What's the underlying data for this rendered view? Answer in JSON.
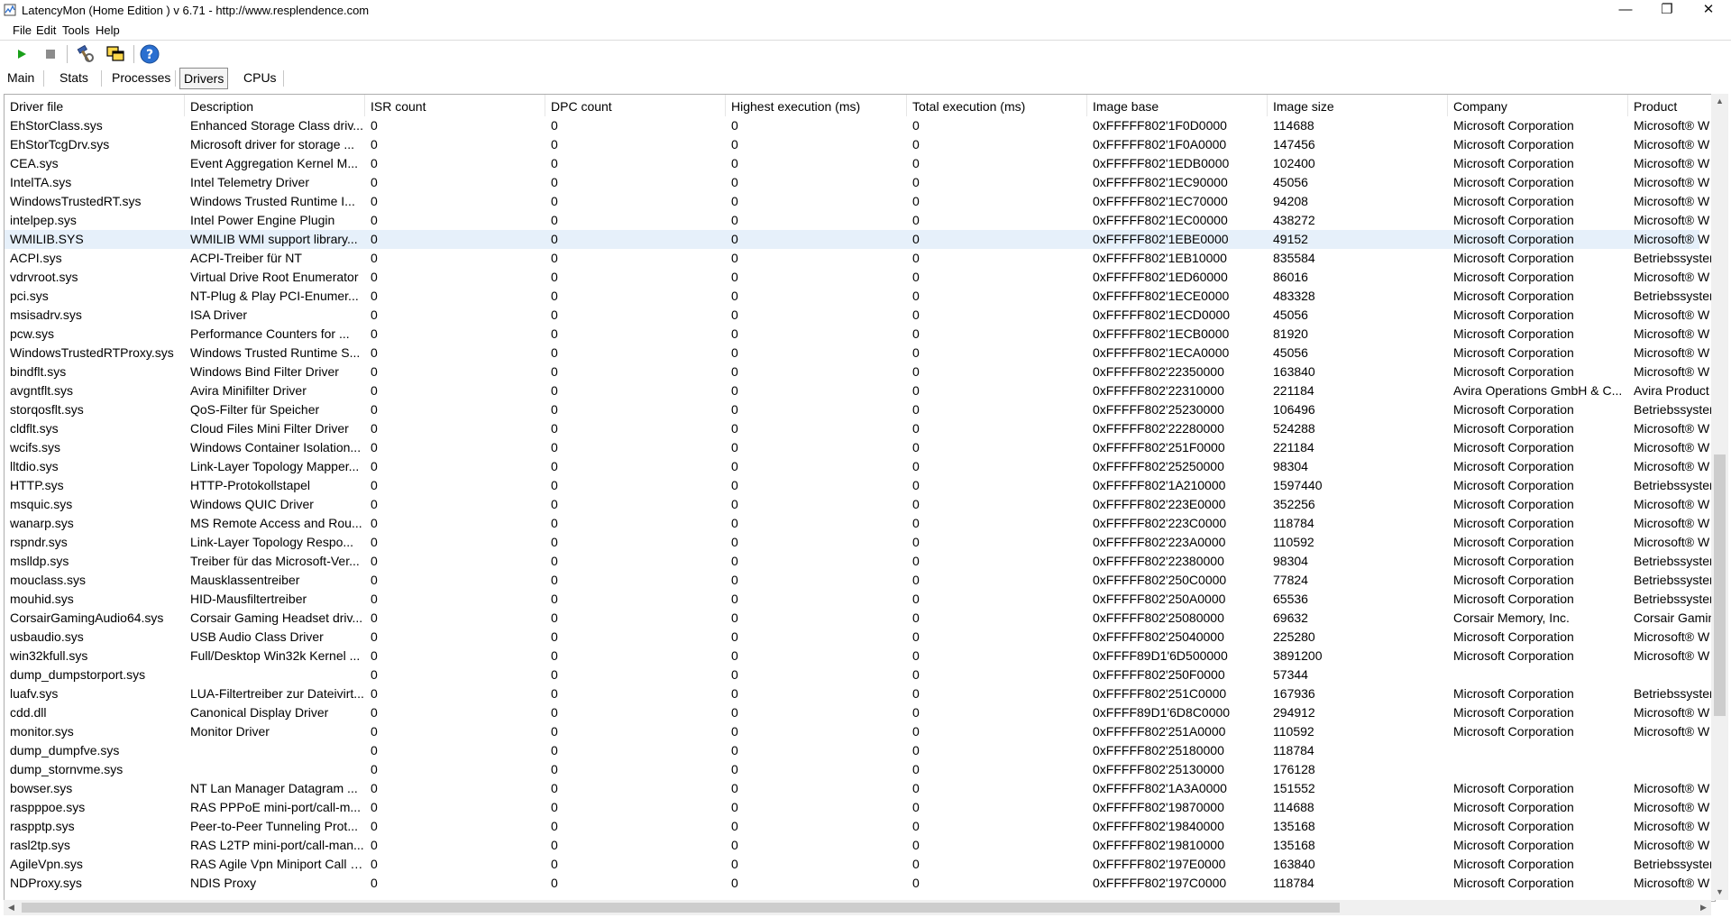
{
  "window": {
    "title": "LatencyMon  (Home Edition )  v 6.71 - http://www.resplendence.com",
    "minimize_glyph": "—",
    "restore_glyph": "❐",
    "close_glyph": "✕"
  },
  "menu": [
    {
      "label": "File"
    },
    {
      "label": "Edit"
    },
    {
      "label": "Tools"
    },
    {
      "label": "Help"
    }
  ],
  "toolbar": {
    "start_icon": "play-icon",
    "stop_icon": "stop-icon",
    "tool1_icon": "wrench-hammer-icon",
    "tool2_icon": "windows-icon",
    "help_icon": "help-icon",
    "start_color": "#1aa01a",
    "help_color": "#2a6fd0"
  },
  "tabs": [
    {
      "label": "Main"
    },
    {
      "label": "Stats"
    },
    {
      "label": "Processes"
    },
    {
      "label": "Drivers",
      "active": true
    },
    {
      "label": "CPUs"
    }
  ],
  "table": {
    "columns": [
      "Driver file",
      "Description",
      "ISR count",
      "DPC count",
      "Highest execution (ms)",
      "Total execution (ms)",
      "Image base",
      "Image size",
      "Company",
      "Product"
    ],
    "selected_row": 6,
    "rows": [
      [
        "EhStorClass.sys",
        "Enhanced Storage Class driv...",
        "0",
        "0",
        "0",
        "0",
        "0xFFFFF802'1F0D0000",
        "114688",
        "Microsoft Corporation",
        "Microsoft® W"
      ],
      [
        "EhStorTcgDrv.sys",
        "Microsoft driver for storage ...",
        "0",
        "0",
        "0",
        "0",
        "0xFFFFF802'1F0A0000",
        "147456",
        "Microsoft Corporation",
        "Microsoft® W"
      ],
      [
        "CEA.sys",
        "Event Aggregation Kernel M...",
        "0",
        "0",
        "0",
        "0",
        "0xFFFFF802'1EDB0000",
        "102400",
        "Microsoft Corporation",
        "Microsoft® W"
      ],
      [
        "IntelTA.sys",
        "Intel Telemetry Driver",
        "0",
        "0",
        "0",
        "0",
        "0xFFFFF802'1EC90000",
        "45056",
        "Microsoft Corporation",
        "Microsoft® W"
      ],
      [
        "WindowsTrustedRT.sys",
        "Windows Trusted Runtime I...",
        "0",
        "0",
        "0",
        "0",
        "0xFFFFF802'1EC70000",
        "94208",
        "Microsoft Corporation",
        "Microsoft® W"
      ],
      [
        "intelpep.sys",
        "Intel Power Engine Plugin",
        "0",
        "0",
        "0",
        "0",
        "0xFFFFF802'1EC00000",
        "438272",
        "Microsoft Corporation",
        "Microsoft® W"
      ],
      [
        "WMILIB.SYS",
        "WMILIB WMI support library...",
        "0",
        "0",
        "0",
        "0",
        "0xFFFFF802'1EBE0000",
        "49152",
        "Microsoft Corporation",
        "Microsoft® W"
      ],
      [
        "ACPI.sys",
        "ACPI-Treiber für NT",
        "0",
        "0",
        "0",
        "0",
        "0xFFFFF802'1EB10000",
        "835584",
        "Microsoft Corporation",
        "Betriebssyster"
      ],
      [
        "vdrvroot.sys",
        "Virtual Drive Root Enumerator",
        "0",
        "0",
        "0",
        "0",
        "0xFFFFF802'1ED60000",
        "86016",
        "Microsoft Corporation",
        "Microsoft® W"
      ],
      [
        "pci.sys",
        "NT-Plug & Play PCI-Enumer...",
        "0",
        "0",
        "0",
        "0",
        "0xFFFFF802'1ECE0000",
        "483328",
        "Microsoft Corporation",
        "Betriebssyster"
      ],
      [
        "msisadrv.sys",
        "ISA Driver",
        "0",
        "0",
        "0",
        "0",
        "0xFFFFF802'1ECD0000",
        "45056",
        "Microsoft Corporation",
        "Microsoft® W"
      ],
      [
        "pcw.sys",
        "Performance Counters for ...",
        "0",
        "0",
        "0",
        "0",
        "0xFFFFF802'1ECB0000",
        "81920",
        "Microsoft Corporation",
        "Microsoft® W"
      ],
      [
        "WindowsTrustedRTProxy.sys",
        "Windows Trusted Runtime S...",
        "0",
        "0",
        "0",
        "0",
        "0xFFFFF802'1ECA0000",
        "45056",
        "Microsoft Corporation",
        "Microsoft® W"
      ],
      [
        "bindflt.sys",
        "Windows Bind Filter Driver",
        "0",
        "0",
        "0",
        "0",
        "0xFFFFF802'22350000",
        "163840",
        "Microsoft Corporation",
        "Microsoft® W"
      ],
      [
        "avgntflt.sys",
        "Avira Minifilter Driver",
        "0",
        "0",
        "0",
        "0",
        "0xFFFFF802'22310000",
        "221184",
        "Avira Operations GmbH & C...",
        "Avira Product"
      ],
      [
        "storqosflt.sys",
        "QoS-Filter für Speicher",
        "0",
        "0",
        "0",
        "0",
        "0xFFFFF802'25230000",
        "106496",
        "Microsoft Corporation",
        "Betriebssyster"
      ],
      [
        "cldflt.sys",
        "Cloud Files Mini Filter Driver",
        "0",
        "0",
        "0",
        "0",
        "0xFFFFF802'22280000",
        "524288",
        "Microsoft Corporation",
        "Microsoft® W"
      ],
      [
        "wcifs.sys",
        "Windows Container Isolation...",
        "0",
        "0",
        "0",
        "0",
        "0xFFFFF802'251F0000",
        "221184",
        "Microsoft Corporation",
        "Microsoft® W"
      ],
      [
        "lltdio.sys",
        "Link-Layer Topology Mapper...",
        "0",
        "0",
        "0",
        "0",
        "0xFFFFF802'25250000",
        "98304",
        "Microsoft Corporation",
        "Microsoft® W"
      ],
      [
        "HTTP.sys",
        "HTTP-Protokollstapel",
        "0",
        "0",
        "0",
        "0",
        "0xFFFFF802'1A210000",
        "1597440",
        "Microsoft Corporation",
        "Betriebssyster"
      ],
      [
        "msquic.sys",
        "Windows QUIC Driver",
        "0",
        "0",
        "0",
        "0",
        "0xFFFFF802'223E0000",
        "352256",
        "Microsoft Corporation",
        "Microsoft® W"
      ],
      [
        "wanarp.sys",
        "MS Remote Access and Rou...",
        "0",
        "0",
        "0",
        "0",
        "0xFFFFF802'223C0000",
        "118784",
        "Microsoft Corporation",
        "Microsoft® W"
      ],
      [
        "rspndr.sys",
        "Link-Layer Topology Respo...",
        "0",
        "0",
        "0",
        "0",
        "0xFFFFF802'223A0000",
        "110592",
        "Microsoft Corporation",
        "Microsoft® W"
      ],
      [
        "mslldp.sys",
        "Treiber für das Microsoft-Ver...",
        "0",
        "0",
        "0",
        "0",
        "0xFFFFF802'22380000",
        "98304",
        "Microsoft Corporation",
        "Betriebssyster"
      ],
      [
        "mouclass.sys",
        "Mausklassentreiber",
        "0",
        "0",
        "0",
        "0",
        "0xFFFFF802'250C0000",
        "77824",
        "Microsoft Corporation",
        "Betriebssyster"
      ],
      [
        "mouhid.sys",
        "HID-Mausfiltertreiber",
        "0",
        "0",
        "0",
        "0",
        "0xFFFFF802'250A0000",
        "65536",
        "Microsoft Corporation",
        "Betriebssyster"
      ],
      [
        "CorsairGamingAudio64.sys",
        "Corsair Gaming Headset driv...",
        "0",
        "0",
        "0",
        "0",
        "0xFFFFF802'25080000",
        "69632",
        "Corsair Memory, Inc.",
        "Corsair Gamin"
      ],
      [
        "usbaudio.sys",
        "USB Audio Class Driver",
        "0",
        "0",
        "0",
        "0",
        "0xFFFFF802'25040000",
        "225280",
        "Microsoft Corporation",
        "Microsoft® W"
      ],
      [
        "win32kfull.sys",
        "Full/Desktop Win32k Kernel ...",
        "0",
        "0",
        "0",
        "0",
        "0xFFFF89D1'6D500000",
        "3891200",
        "Microsoft Corporation",
        "Microsoft® W"
      ],
      [
        "dump_dumpstorport.sys",
        "",
        "0",
        "0",
        "0",
        "0",
        "0xFFFFF802'250F0000",
        "57344",
        "",
        ""
      ],
      [
        "luafv.sys",
        "LUA-Filtertreiber zur Dateivirt...",
        "0",
        "0",
        "0",
        "0",
        "0xFFFFF802'251C0000",
        "167936",
        "Microsoft Corporation",
        "Betriebssyster"
      ],
      [
        "cdd.dll",
        "Canonical Display Driver",
        "0",
        "0",
        "0",
        "0",
        "0xFFFF89D1'6D8C0000",
        "294912",
        "Microsoft Corporation",
        "Microsoft® W"
      ],
      [
        "monitor.sys",
        "Monitor Driver",
        "0",
        "0",
        "0",
        "0",
        "0xFFFFF802'251A0000",
        "110592",
        "Microsoft Corporation",
        "Microsoft® W"
      ],
      [
        "dump_dumpfve.sys",
        "",
        "0",
        "0",
        "0",
        "0",
        "0xFFFFF802'25180000",
        "118784",
        "",
        ""
      ],
      [
        "dump_stornvme.sys",
        "",
        "0",
        "0",
        "0",
        "0",
        "0xFFFFF802'25130000",
        "176128",
        "",
        ""
      ],
      [
        "bowser.sys",
        "NT Lan Manager Datagram ...",
        "0",
        "0",
        "0",
        "0",
        "0xFFFFF802'1A3A0000",
        "151552",
        "Microsoft Corporation",
        "Microsoft® W"
      ],
      [
        "raspppoe.sys",
        "RAS PPPoE mini-port/call-m...",
        "0",
        "0",
        "0",
        "0",
        "0xFFFFF802'19870000",
        "114688",
        "Microsoft Corporation",
        "Microsoft® W"
      ],
      [
        "raspptp.sys",
        "Peer-to-Peer Tunneling Prot...",
        "0",
        "0",
        "0",
        "0",
        "0xFFFFF802'19840000",
        "135168",
        "Microsoft Corporation",
        "Microsoft® W"
      ],
      [
        "rasl2tp.sys",
        "RAS L2TP mini-port/call-man...",
        "0",
        "0",
        "0",
        "0",
        "0xFFFFF802'19810000",
        "135168",
        "Microsoft Corporation",
        "Microsoft® W"
      ],
      [
        "AgileVpn.sys",
        "RAS Agile Vpn Miniport Call M...",
        "0",
        "0",
        "0",
        "0",
        "0xFFFFF802'197E0000",
        "163840",
        "Microsoft Corporation",
        "Betriebssyster"
      ],
      [
        "NDProxy.sys",
        "NDIS Proxy",
        "0",
        "0",
        "0",
        "0",
        "0xFFFFF802'197C0000",
        "118784",
        "Microsoft Corporation",
        "Microsoft® W"
      ]
    ]
  },
  "scrollbars": {
    "up_glyph": "▲",
    "down_glyph": "▼",
    "left_glyph": "◀",
    "right_glyph": "▶"
  }
}
